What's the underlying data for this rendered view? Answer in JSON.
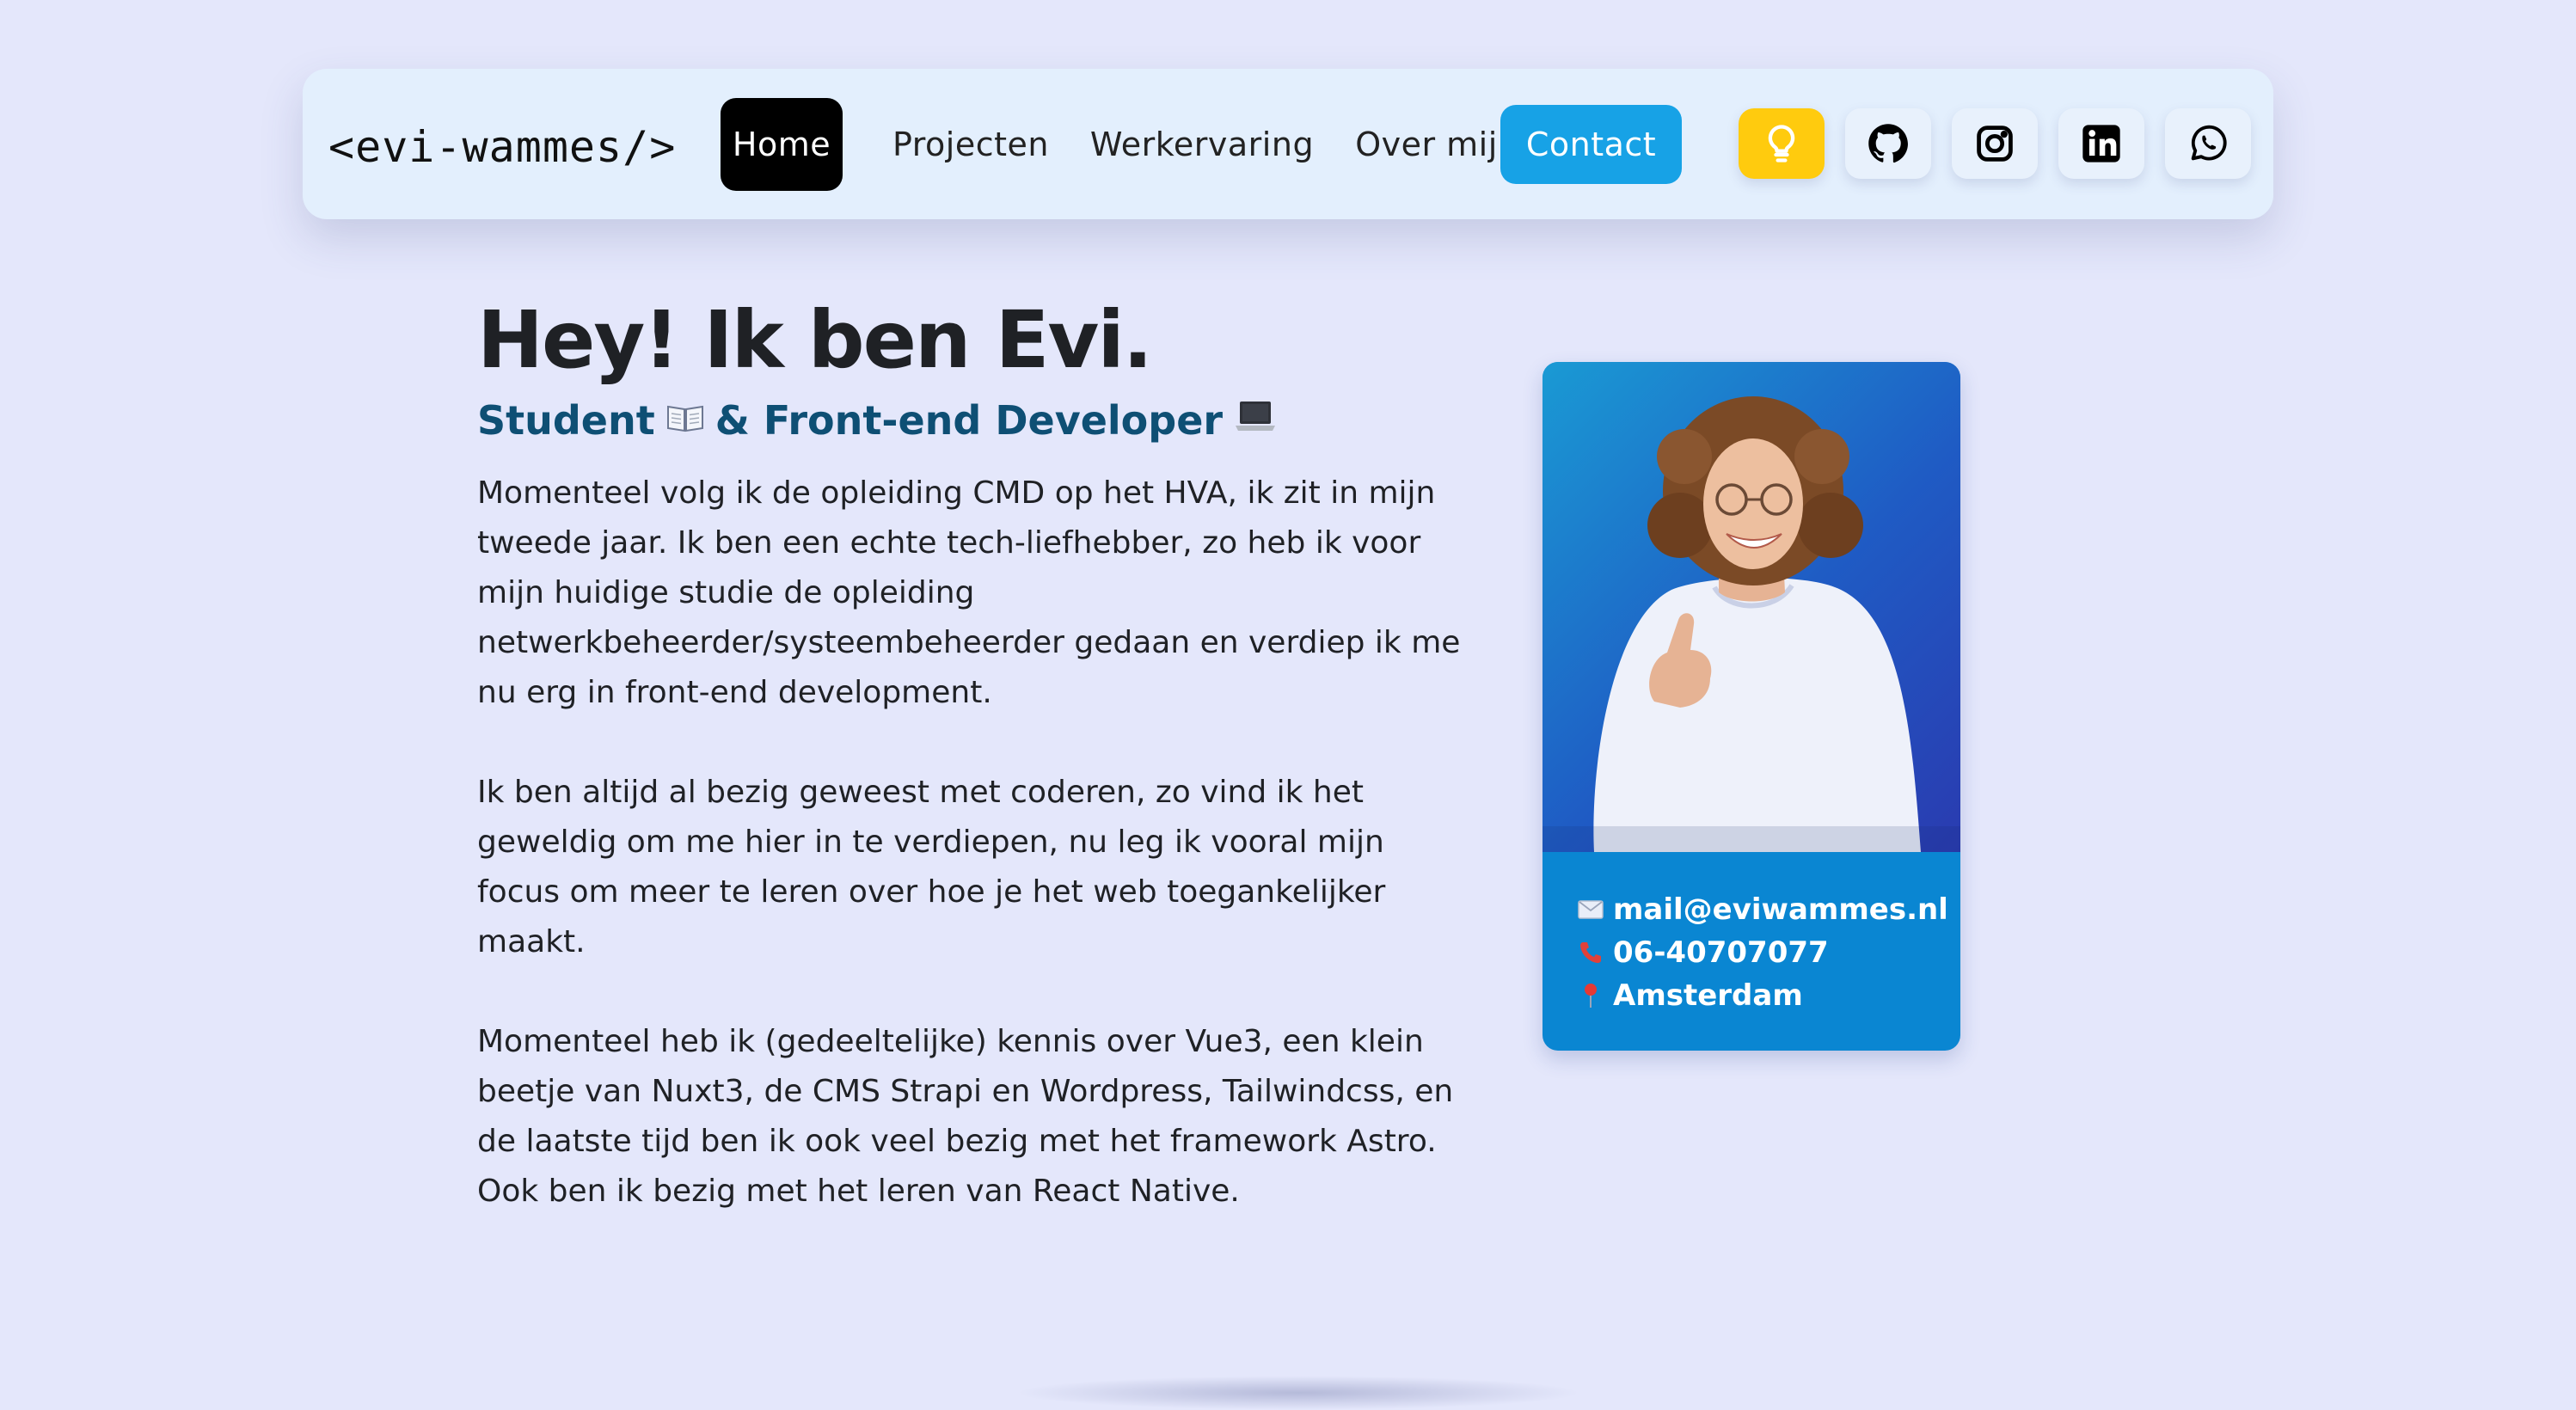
{
  "nav": {
    "logo": "<evi-wammes/>",
    "links": [
      {
        "label": "Home"
      },
      {
        "label": "Projecten"
      },
      {
        "label": "Werkervaring"
      },
      {
        "label": "Over mij"
      }
    ],
    "contact_label": "Contact",
    "icons": [
      "lightbulb-icon",
      "github-icon",
      "instagram-icon",
      "linkedin-icon",
      "whatsapp-icon"
    ],
    "active_color": "#000000",
    "contact_color": "#17a2e6",
    "theme_toggle_color": "#ffcb0e"
  },
  "hero": {
    "title": "Hey! Ik ben Evi.",
    "subtitle_part1": "Student",
    "subtitle_emoji1": "book-icon",
    "subtitle_part2": "& Front-end Developer",
    "subtitle_emoji2": "laptop-icon",
    "paragraphs": [
      "Momenteel volg ik de opleiding CMD op het HVA, ik zit in mijn tweede jaar. Ik ben een echte tech-liefhebber, zo heb ik voor mijn huidige studie de opleiding netwerkbeheerder/systeembeheerder gedaan en verdiep ik me nu erg in front-end development.",
      "Ik ben altijd al bezig geweest met coderen, zo vind ik het geweldig om me hier in te verdiepen, nu leg ik vooral mijn focus om meer te leren over hoe je het web toegankelijker maakt.",
      "Momenteel heb ik (gedeeltelijke) kennis over Vue3, een klein beetje van Nuxt3, de CMS Strapi en Wordpress, Tailwindcss, en de laatste tijd ben ik ook veel bezig met het framework Astro. Ook ben ik bezig met het leren van React Native."
    ]
  },
  "card": {
    "email": "mail@eviwammes.nl",
    "phone": "06-40707077",
    "location": "Amsterdam",
    "icons": [
      "envelope-icon",
      "phone-icon",
      "pin-icon"
    ]
  }
}
